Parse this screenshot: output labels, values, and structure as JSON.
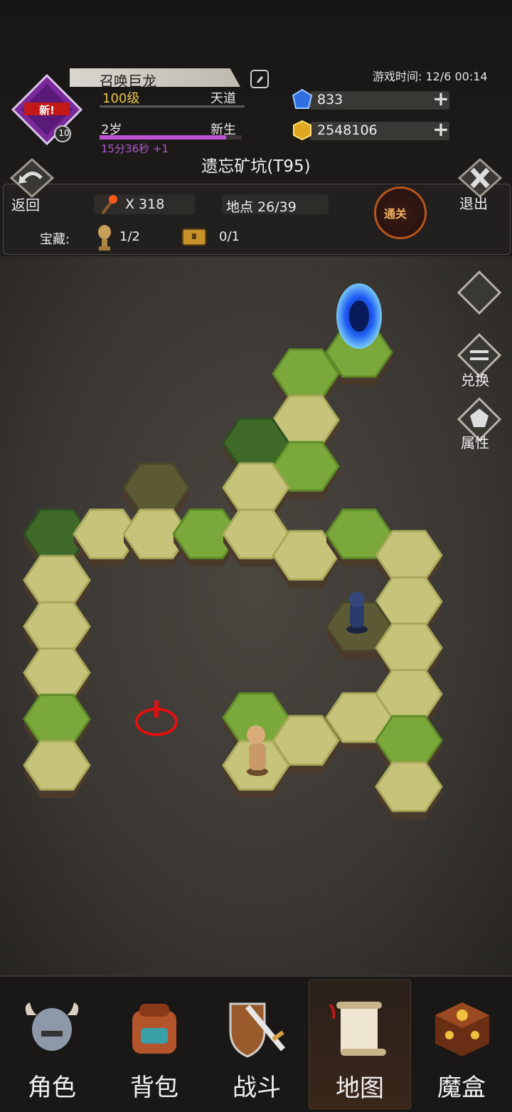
{
  "player": {
    "name": "召唤巨龙",
    "level": "100级",
    "realm": "天道",
    "age": "2岁",
    "stage": "新生",
    "timer": "15分36秒 +1",
    "badge_text": "新!",
    "badge_number": "10",
    "exp_progress": 0.89
  },
  "game_time": "游戏时间: 12/6 00:14",
  "currency": {
    "gems": "833",
    "gold": "2548106"
  },
  "dungeon": {
    "title": "遗忘矿坑(T95)",
    "back_label": "返回",
    "exit_label": "退出",
    "torch_count": "X 318",
    "location": "地点 26/39",
    "clear_label": "通关",
    "treasure_label": "宝藏:",
    "trophy_count": "1/2",
    "chest_count": "0/1"
  },
  "side_buttons": {
    "exchange": "兑换",
    "attributes": "属性"
  },
  "nav": {
    "role": "角色",
    "bag": "背包",
    "battle": "战斗",
    "map": "地图",
    "magic_box": "魔盒"
  },
  "colors": {
    "accent_gold": "#e8c545",
    "exp_purple": "#c050d4",
    "clear_orange": "#b8541c"
  }
}
